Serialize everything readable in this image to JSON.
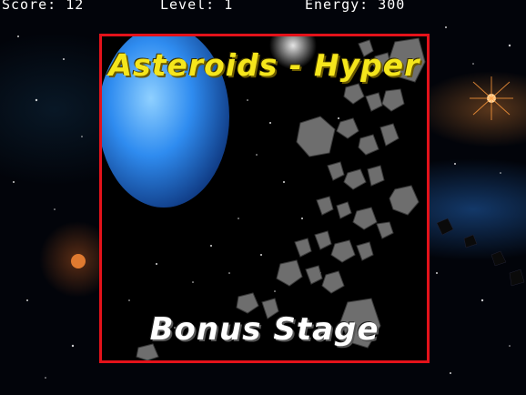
{
  "hud": {
    "score_text": "Score: 12",
    "level_text": "Level: 1",
    "energy_text": "Energy: 300"
  },
  "splash": {
    "title": "Asteroids - Hyper",
    "subtitle": "Bonus Stage"
  },
  "colors": {
    "frame": "#e4121a",
    "title": "#f5e61c",
    "subtitle": "#ffffff",
    "planet": "#2f8cf0"
  }
}
